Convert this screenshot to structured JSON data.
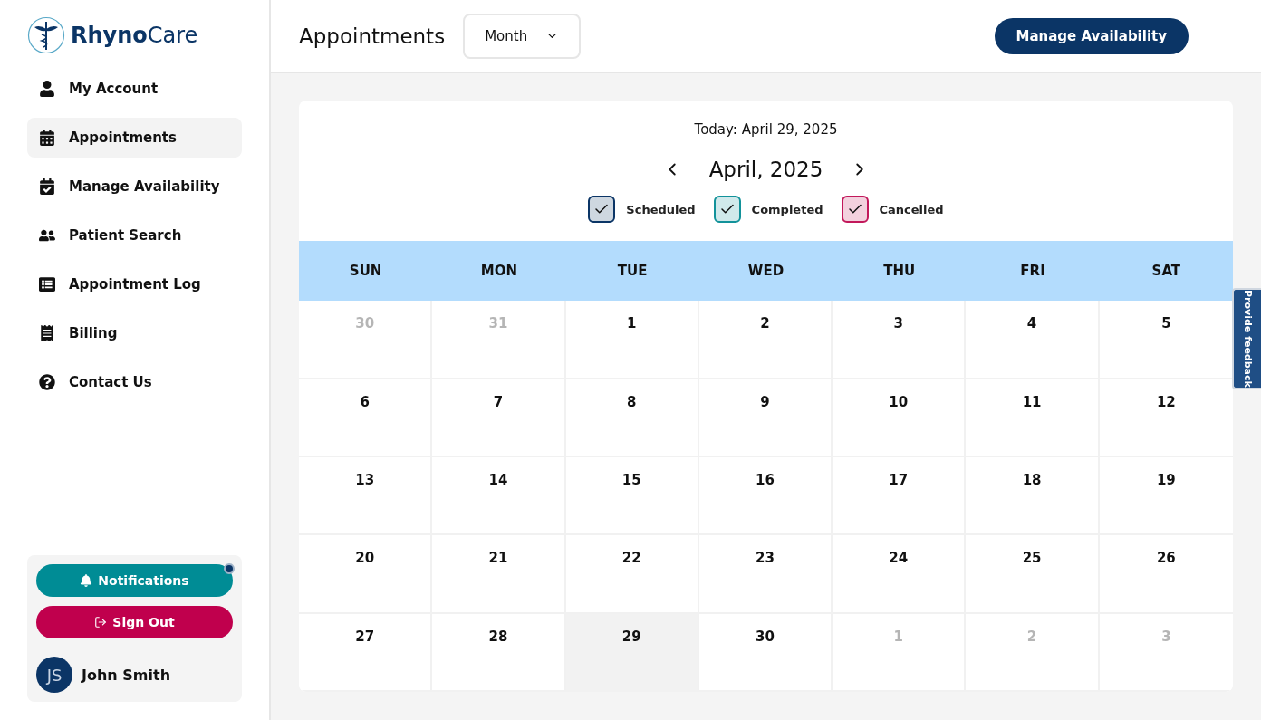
{
  "logo": {
    "brand_bold": "Rhyno",
    "brand_light": "Care"
  },
  "nav": [
    {
      "label": "My Account",
      "selected": false
    },
    {
      "label": "Appointments",
      "selected": true
    },
    {
      "label": "Manage Availability",
      "selected": false
    },
    {
      "label": "Patient Search",
      "selected": false
    },
    {
      "label": "Appointment Log",
      "selected": false
    },
    {
      "label": "Billing",
      "selected": false
    },
    {
      "label": "Contact Us",
      "selected": false
    }
  ],
  "account": {
    "notifications": {
      "label": "Notifications",
      "unread": true
    },
    "sign_out": "Sign Out",
    "user": {
      "initials": "JS",
      "name": "John Smith"
    }
  },
  "header": {
    "title": "Appointments",
    "view_select": {
      "value": "Month"
    },
    "action": "Manage Availability"
  },
  "calendar": {
    "today": "Today: April 29, 2025",
    "month": "April, 2025",
    "legend": [
      {
        "label": "Scheduled",
        "checked": true,
        "color": "#0b3566"
      },
      {
        "label": "Completed",
        "checked": true,
        "color": "#12929a"
      },
      {
        "label": "Cancelled",
        "checked": true,
        "color": "#c2185b"
      }
    ],
    "weekdays": [
      "SUN",
      "MON",
      "TUE",
      "WED",
      "THU",
      "FRI",
      "SAT"
    ],
    "weeks": [
      [
        {
          "day": "30",
          "in_month": false,
          "today": false
        },
        {
          "day": "31",
          "in_month": false,
          "today": false
        },
        {
          "day": "1",
          "in_month": true,
          "today": false
        },
        {
          "day": "2",
          "in_month": true,
          "today": false
        },
        {
          "day": "3",
          "in_month": true,
          "today": false
        },
        {
          "day": "4",
          "in_month": true,
          "today": false
        },
        {
          "day": "5",
          "in_month": true,
          "today": false
        }
      ],
      [
        {
          "day": "6",
          "in_month": true,
          "today": false
        },
        {
          "day": "7",
          "in_month": true,
          "today": false
        },
        {
          "day": "8",
          "in_month": true,
          "today": false
        },
        {
          "day": "9",
          "in_month": true,
          "today": false
        },
        {
          "day": "10",
          "in_month": true,
          "today": false
        },
        {
          "day": "11",
          "in_month": true,
          "today": false
        },
        {
          "day": "12",
          "in_month": true,
          "today": false
        }
      ],
      [
        {
          "day": "13",
          "in_month": true,
          "today": false
        },
        {
          "day": "14",
          "in_month": true,
          "today": false
        },
        {
          "day": "15",
          "in_month": true,
          "today": false
        },
        {
          "day": "16",
          "in_month": true,
          "today": false
        },
        {
          "day": "17",
          "in_month": true,
          "today": false
        },
        {
          "day": "18",
          "in_month": true,
          "today": false
        },
        {
          "day": "19",
          "in_month": true,
          "today": false
        }
      ],
      [
        {
          "day": "20",
          "in_month": true,
          "today": false
        },
        {
          "day": "21",
          "in_month": true,
          "today": false
        },
        {
          "day": "22",
          "in_month": true,
          "today": false
        },
        {
          "day": "23",
          "in_month": true,
          "today": false
        },
        {
          "day": "24",
          "in_month": true,
          "today": false
        },
        {
          "day": "25",
          "in_month": true,
          "today": false
        },
        {
          "day": "26",
          "in_month": true,
          "today": false
        }
      ],
      [
        {
          "day": "27",
          "in_month": true,
          "today": false
        },
        {
          "day": "28",
          "in_month": true,
          "today": false
        },
        {
          "day": "29",
          "in_month": true,
          "today": true
        },
        {
          "day": "30",
          "in_month": true,
          "today": false
        },
        {
          "day": "1",
          "in_month": false,
          "today": false
        },
        {
          "day": "2",
          "in_month": false,
          "today": false
        },
        {
          "day": "3",
          "in_month": false,
          "today": false
        }
      ]
    ]
  },
  "feedback_tab": "Provide feedback"
}
